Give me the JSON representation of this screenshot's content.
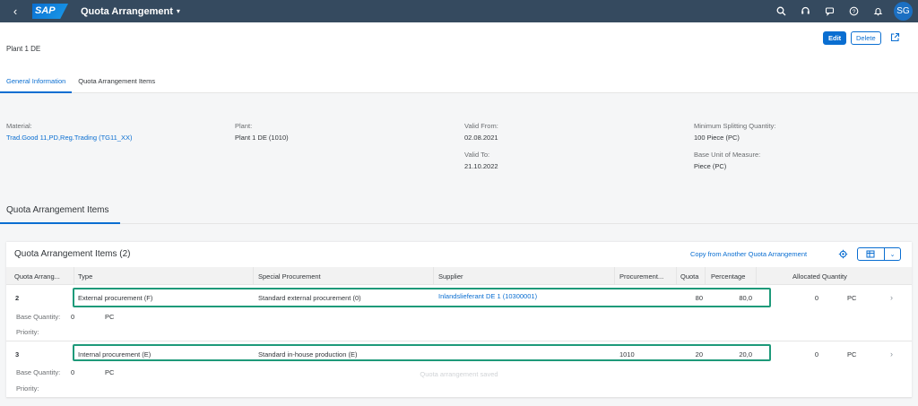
{
  "shell": {
    "logo": "SAP",
    "app_title": "Quota Arrangement",
    "avatar": "SG"
  },
  "header": {
    "title": "Plant 1 DE",
    "edit_label": "Edit",
    "delete_label": "Delete",
    "tabs": [
      {
        "label": "General Information",
        "active": true
      },
      {
        "label": "Quota Arrangement Items",
        "active": false
      }
    ]
  },
  "general": {
    "material_label": "Material:",
    "material_value": "Trad.Good 11,PD,Reg.Trading (TG11_XX)",
    "plant_label": "Plant:",
    "plant_value": "Plant 1 DE (1010)",
    "valid_from_label": "Valid From:",
    "valid_from_value": "02.08.2021",
    "valid_to_label": "Valid To:",
    "valid_to_value": "21.10.2022",
    "min_split_label": "Minimum Splitting Quantity:",
    "min_split_value": "100  Piece (PC)",
    "base_uom_label": "Base Unit of Measure:",
    "base_uom_value": "Piece (PC)"
  },
  "items_section": {
    "heading": "Quota Arrangement Items",
    "table_title": "Quota Arrangement Items (2)",
    "copy_link": "Copy from Another Quota Arrangement",
    "columns": {
      "quota_arr": "Quota Arrang...",
      "type": "Type",
      "special": "Special Procurement",
      "supplier": "Supplier",
      "procurement": "Procurement...",
      "quota": "Quota",
      "percentage": "Percentage",
      "allocated": "Allocated Quantity"
    },
    "rows": [
      {
        "number": "2",
        "type": "External procurement (F)",
        "special": "Standard external procurement (0)",
        "supplier": "Inlandslieferant DE 1 (10300001)",
        "procurement": "",
        "quota": "80",
        "percentage": "80,0",
        "allocated": "0",
        "unit": "PC",
        "base_qty_label": "Base Quantity:",
        "base_qty_value": "0",
        "base_qty_unit": "PC",
        "priority_label": "Priority:"
      },
      {
        "number": "3",
        "type": "Internal procurement (E)",
        "special": "Standard in-house production (E)",
        "supplier": "",
        "procurement": "1010",
        "quota": "20",
        "percentage": "20,0",
        "allocated": "0",
        "unit": "PC",
        "base_qty_label": "Base Quantity:",
        "base_qty_value": "0",
        "base_qty_unit": "PC",
        "priority_label": "Priority:"
      }
    ]
  },
  "toast": "Quota arrangement saved",
  "colors": {
    "shell": "#354a5f",
    "accent": "#0a6ed1",
    "highlight": "#1e9a7a"
  }
}
